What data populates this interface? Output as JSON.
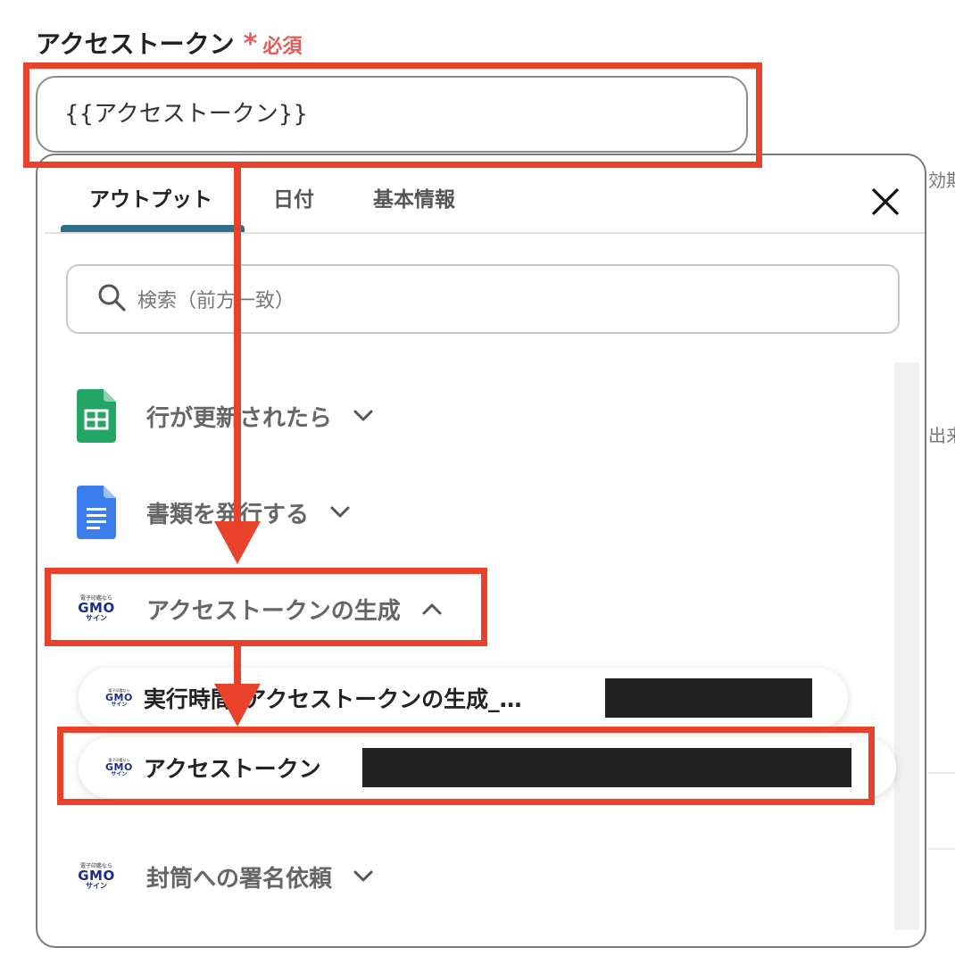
{
  "field": {
    "label": "アクセストークン",
    "required_mark": "*",
    "required_text": "必須",
    "value": "{{アクセストークン}}"
  },
  "side_text": {
    "top": "効期",
    "middle": "出来"
  },
  "panel": {
    "tabs": [
      {
        "label": "アウトプット",
        "active": true
      },
      {
        "label": "日付",
        "active": false
      },
      {
        "label": "基本情報",
        "active": false
      }
    ],
    "search_placeholder": "検索（前方一致）",
    "sections": [
      {
        "label": "行が更新されたら",
        "icon": "google-sheets-icon",
        "expanded": false
      },
      {
        "label": "書類を発行する",
        "icon": "google-docs-icon",
        "expanded": false
      },
      {
        "label": "アクセストークンの生成",
        "icon": "gmo-sign-logo-icon",
        "expanded": true
      },
      {
        "label": "封筒への署名依頼",
        "icon": "gmo-sign-logo-icon",
        "expanded": false
      }
    ],
    "outputs": [
      {
        "label": "実行時間_アクセストークンの生成_…"
      },
      {
        "label": "アクセストークン"
      }
    ]
  },
  "gmo_logo": {
    "top": "電子印鑑なら",
    "mid": "GMO",
    "bottom": "サイン"
  },
  "colors": {
    "annotation": "#e8422b",
    "required": "#e85a5a",
    "tab_underline": "#2f6d8c"
  }
}
